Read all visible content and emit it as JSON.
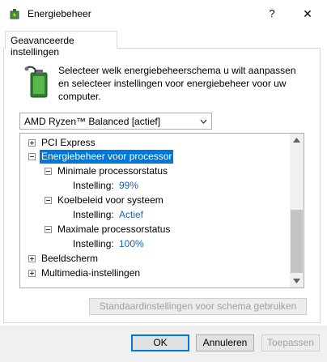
{
  "window": {
    "title": "Energiebeheer",
    "help_glyph": "?",
    "close_glyph": "✕"
  },
  "tab": {
    "label": "Geavanceerde instellingen"
  },
  "intro_text": "Selecteer welk energiebeheerschema u wilt aanpassen en selecteer instellingen voor energiebeheer voor uw computer.",
  "plan_select": {
    "value": "AMD Ryzen™ Balanced [actief]"
  },
  "tree": {
    "pci_express": "PCI Express",
    "processor": "Energiebeheer voor processor",
    "min_state": "Minimale processorstatus",
    "min_setting_label": "Instelling:",
    "min_setting_value": "99%",
    "cooling": "Koelbeleid voor systeem",
    "cooling_setting_label": "Instelling:",
    "cooling_setting_value": "Actief",
    "max_state": "Maximale processorstatus",
    "max_setting_label": "Instelling:",
    "max_setting_value": "100%",
    "display": "Beeldscherm",
    "multimedia": "Multimedia-instellingen"
  },
  "restore_button": "Standaardinstellingen voor schema gebruiken",
  "buttons": {
    "ok": "OK",
    "cancel": "Annuleren",
    "apply": "Toepassen"
  },
  "colors": {
    "selection": "#0078d7",
    "value_link": "#1a63b4"
  }
}
